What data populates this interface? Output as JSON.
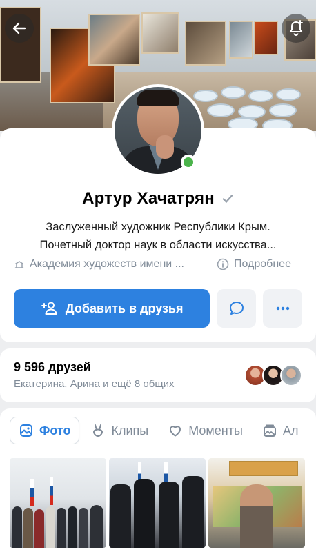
{
  "header": {
    "back_icon": "arrow-left-icon",
    "bell_icon": "bell-plus-icon"
  },
  "profile": {
    "name": "Артур Хачатрян",
    "verified_icon": "checkmark-icon",
    "online": true,
    "bio_line1": "Заслуженный художник Республики Крым.",
    "bio_line2": "Почетный доктор наук в области искусства...",
    "organization": "Академия художеств имени ...",
    "organization_icon": "building-icon",
    "more_label": "Подробнее",
    "more_icon": "info-icon"
  },
  "actions": {
    "add_friend_label": "Добавить в друзья",
    "add_friend_icon": "person-add-icon",
    "message_icon": "chat-bubble-icon",
    "more_icon": "more-horizontal-icon"
  },
  "friends": {
    "count_label": "9 596 друзей",
    "mutual_label": "Екатерина, Арина и ещё 8 общих"
  },
  "tabs": [
    {
      "label": "Фото",
      "icon": "image-icon",
      "active": true
    },
    {
      "label": "Клипы",
      "icon": "clips-icon",
      "active": false
    },
    {
      "label": "Моменты",
      "icon": "heart-icon",
      "active": false
    },
    {
      "label": "Ал",
      "icon": "album-icon",
      "active": false
    }
  ],
  "colors": {
    "accent": "#2d81e0",
    "secondary_text": "#818c99",
    "online": "#4bb34b"
  }
}
